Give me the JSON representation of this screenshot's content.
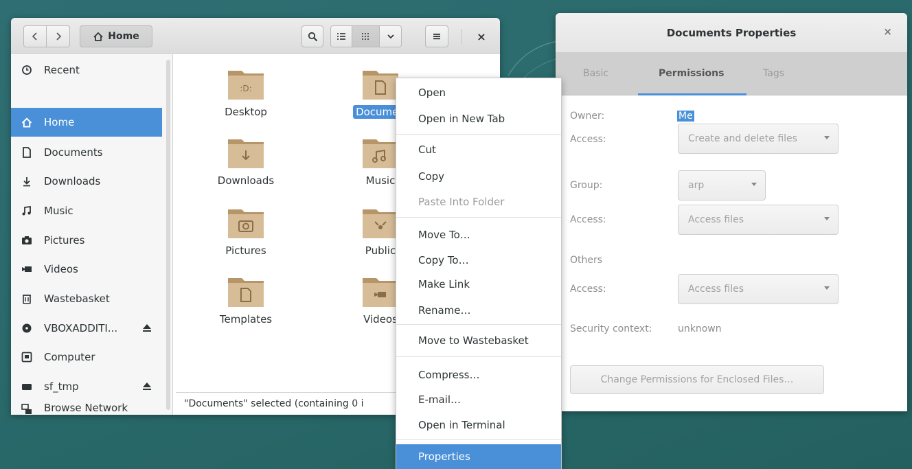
{
  "colors": {
    "accent": "#4a90d9",
    "desktop": "#2b6b6d"
  },
  "file_manager": {
    "header": {
      "back_icon": "chevron-left-icon",
      "forward_icon": "chevron-right-icon",
      "location_label": "Home",
      "location_icon": "home-icon",
      "search_icon": "search-icon",
      "list_view_icon": "list-view-icon",
      "grid_view_icon": "grid-view-icon",
      "view_menu_icon": "chevron-down-icon",
      "menu_icon": "hamburger-menu-icon",
      "close_label": "×"
    },
    "sidebar": {
      "items": [
        {
          "label": "Recent",
          "icon": "clock-icon"
        },
        {
          "label": "Home",
          "icon": "home-icon",
          "selected": true
        },
        {
          "label": "Documents",
          "icon": "document-icon"
        },
        {
          "label": "Downloads",
          "icon": "download-icon"
        },
        {
          "label": "Music",
          "icon": "music-icon"
        },
        {
          "label": "Pictures",
          "icon": "camera-icon"
        },
        {
          "label": "Videos",
          "icon": "video-icon"
        },
        {
          "label": "Wastebasket",
          "icon": "trash-icon"
        },
        {
          "label": "VBOXADDITI...",
          "icon": "disc-icon",
          "eject": true
        },
        {
          "label": "Computer",
          "icon": "computer-icon"
        },
        {
          "label": "sf_tmp",
          "icon": "drive-icon",
          "eject": true
        },
        {
          "label": "Browse Network",
          "icon": "network-icon"
        }
      ]
    },
    "folders": [
      {
        "name": "Desktop",
        "emblem": "D"
      },
      {
        "name": "Documents",
        "display": "Documen",
        "emblem": "doc",
        "selected": true
      },
      {
        "name": "Downloads",
        "emblem": "download"
      },
      {
        "name": "Music",
        "emblem": "music"
      },
      {
        "name": "Pictures",
        "emblem": "camera"
      },
      {
        "name": "Public",
        "emblem": "share"
      },
      {
        "name": "Templates",
        "emblem": "template"
      },
      {
        "name": "Videos",
        "emblem": "video"
      }
    ],
    "status": "\"Documents\" selected  (containing 0 i"
  },
  "context_menu": {
    "items": [
      {
        "label": "Open"
      },
      {
        "label": "Open in New Tab"
      },
      {
        "label": "Cut"
      },
      {
        "label": "Copy"
      },
      {
        "label": "Paste Into Folder",
        "disabled": true
      },
      {
        "label": "Move To…"
      },
      {
        "label": "Copy To…"
      },
      {
        "label": "Make Link"
      },
      {
        "label": "Rename…"
      },
      {
        "label": "Move to Wastebasket"
      },
      {
        "label": "Compress…"
      },
      {
        "label": "E-mail…"
      },
      {
        "label": "Open in Terminal"
      },
      {
        "label": "Properties",
        "selected": true
      }
    ]
  },
  "properties": {
    "title": "Documents Properties",
    "close_label": "×",
    "tabs": [
      "Basic",
      "Permissions",
      "Tags"
    ],
    "active_tab": "Permissions",
    "owner_label": "Owner:",
    "owner_value": "Me",
    "owner_access_label": "Access:",
    "owner_access_value": "Create and delete files",
    "group_label": "Group:",
    "group_value": "arp",
    "group_access_label": "Access:",
    "group_access_value": "Access files",
    "others_label": "Others",
    "others_access_label": "Access:",
    "others_access_value": "Access files",
    "security_label": "Security context:",
    "security_value": "unknown",
    "change_button": "Change Permissions for Enclosed Files…"
  }
}
